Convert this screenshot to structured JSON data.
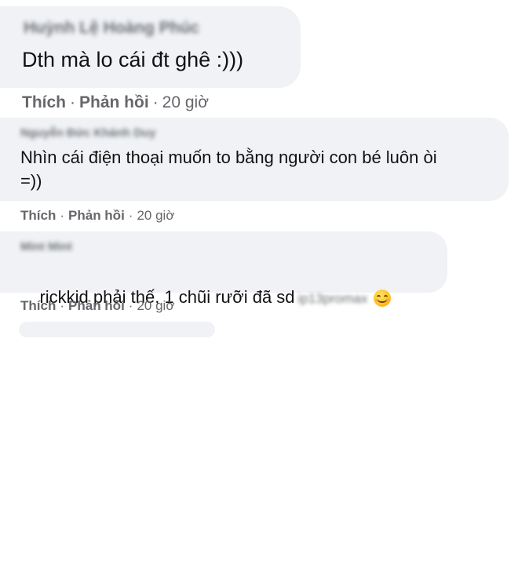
{
  "comments": [
    {
      "author": "Huỳnh Lệ Hoàng Phúc",
      "text": "Dth mà lo cái đt ghê :)))",
      "like_label": "Thích",
      "reply_label": "Phản hồi",
      "separator": "·",
      "time": "20 giờ"
    },
    {
      "author": "Nguyễn Đức Khánh Duy",
      "text": "Nhìn cái điện thoại muốn to bằng người con bé luôn òi\n=))",
      "like_label": "Thích",
      "reply_label": "Phản hồi",
      "separator": "·",
      "time": "20 giờ"
    },
    {
      "author": "Mint Mint",
      "text": "rickkid phải thế, 1 chũi rưỡi đã sd",
      "blurred_text": "ip13promax",
      "emoji": "smiling-face-emoji",
      "like_label": "Thích",
      "reply_label": "Phản hồi",
      "separator": "·",
      "time": "20 giờ"
    }
  ],
  "colors": {
    "bubble": "#f0f2f5",
    "action_text": "#65676b",
    "body_text": "#050505"
  }
}
